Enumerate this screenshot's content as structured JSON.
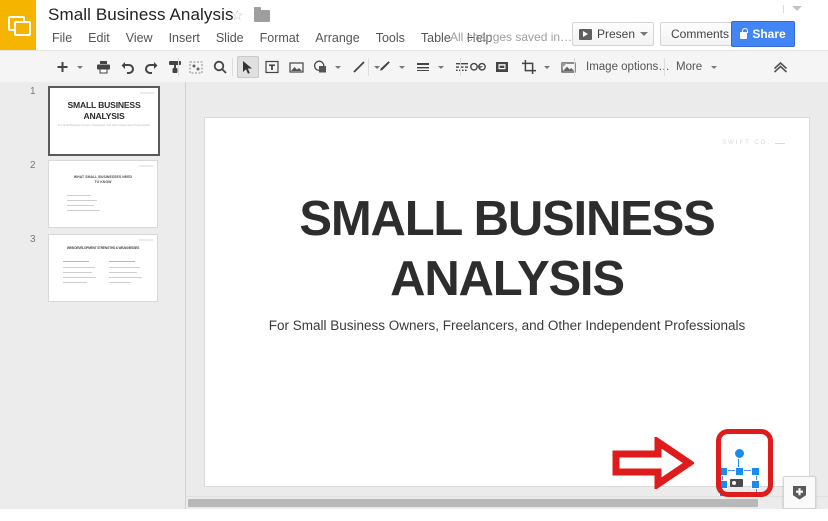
{
  "app": {
    "logo_icon": "slides-logo-icon",
    "accent_color": "#F4B400",
    "share_color": "#4285F4",
    "annotation_color": "#E01B1B"
  },
  "header": {
    "doc_title": "Small Business Analysis",
    "star_icon": "star-outline-icon",
    "folder_icon": "folder-icon",
    "save_status": "All changes saved in…",
    "present_label": "Present",
    "comments_label": "Comments",
    "share_label": "Share",
    "lock_icon": "lock-icon",
    "menus": [
      {
        "label": "File"
      },
      {
        "label": "Edit"
      },
      {
        "label": "View"
      },
      {
        "label": "Insert"
      },
      {
        "label": "Slide"
      },
      {
        "label": "Format"
      },
      {
        "label": "Arrange"
      },
      {
        "label": "Tools"
      },
      {
        "label": "Table"
      },
      {
        "label": "Help"
      }
    ]
  },
  "toolbar": {
    "image_options_label": "Image options…",
    "more_label": "More",
    "items": [
      {
        "name": "new-slide-button",
        "icon": "plus-icon"
      },
      {
        "name": "new-slide-dropdown",
        "icon": "caret-down-icon"
      },
      {
        "name": "print-button",
        "icon": "printer-icon"
      },
      {
        "name": "undo-button",
        "icon": "undo-arrow-icon"
      },
      {
        "name": "redo-button",
        "icon": "redo-arrow-icon"
      },
      {
        "name": "paint-format-button",
        "icon": "paint-roller-icon"
      },
      {
        "name": "fit-to-window-button",
        "icon": "fit-screen-icon"
      },
      {
        "name": "zoom-button",
        "icon": "magnifier-icon"
      },
      {
        "name": "select-tool-button",
        "icon": "cursor-arrow-icon"
      },
      {
        "name": "text-box-button",
        "icon": "text-box-icon"
      },
      {
        "name": "insert-image-button",
        "icon": "image-icon"
      },
      {
        "name": "shape-button",
        "icon": "shape-icon"
      },
      {
        "name": "shape-dropdown",
        "icon": "caret-down-icon"
      },
      {
        "name": "line-button",
        "icon": "line-icon"
      },
      {
        "name": "line-dropdown",
        "icon": "caret-down-icon"
      },
      {
        "name": "fill-color-button",
        "icon": "pencil-icon"
      },
      {
        "name": "fill-color-dropdown",
        "icon": "caret-down-icon"
      },
      {
        "name": "border-weight-button",
        "icon": "lines-icon"
      },
      {
        "name": "border-weight-dropdown",
        "icon": "caret-down-icon"
      },
      {
        "name": "border-dash-button",
        "icon": "dashes-icon"
      },
      {
        "name": "border-dash-dropdown",
        "icon": "caret-down-icon"
      },
      {
        "name": "insert-link-button",
        "icon": "link-icon"
      },
      {
        "name": "insert-comment-button",
        "icon": "comment-box-icon"
      },
      {
        "name": "crop-button",
        "icon": "crop-icon"
      },
      {
        "name": "crop-dropdown",
        "icon": "caret-down-icon"
      },
      {
        "name": "mask-image-button",
        "icon": "mask-image-icon"
      },
      {
        "name": "collapse-toolbar-button",
        "icon": "chevron-up-icon"
      }
    ]
  },
  "filmstrip": {
    "slides": [
      {
        "number": "1",
        "active": true,
        "title": "SMALL BUSINESS ANALYSIS",
        "subtitle": "For Small Business Owners, Freelancers, and Other Independent Professionals"
      },
      {
        "number": "2",
        "active": false,
        "title": "WHAT SMALL BUSINESSES NEED TO KNOW",
        "subtitle": ""
      },
      {
        "number": "3",
        "active": false,
        "title": "WEB DEVELOPMENT STRENGTHS & WEAKNESSES",
        "subtitle": ""
      }
    ]
  },
  "slide": {
    "watermark": "SWIFT CO.",
    "title": "SMALL BUSINESS ANALYSIS",
    "subtitle": "For Small Business Owners, Freelancers, and Other Independent Professionals",
    "selected_object": "inserted-image",
    "selection_handle_color": "#1A8CF0"
  },
  "annotations": {
    "arrow_icon": "red-arrow-right-icon",
    "highlight_icon": "red-rounded-rect-highlight"
  },
  "footer": {
    "explore_icon": "explore-icon",
    "hscroll_icon": "horizontal-scrollbar",
    "vscroll_icon": "vertical-scrollbar",
    "resize_handle_icon": "drag-dots-icon"
  }
}
